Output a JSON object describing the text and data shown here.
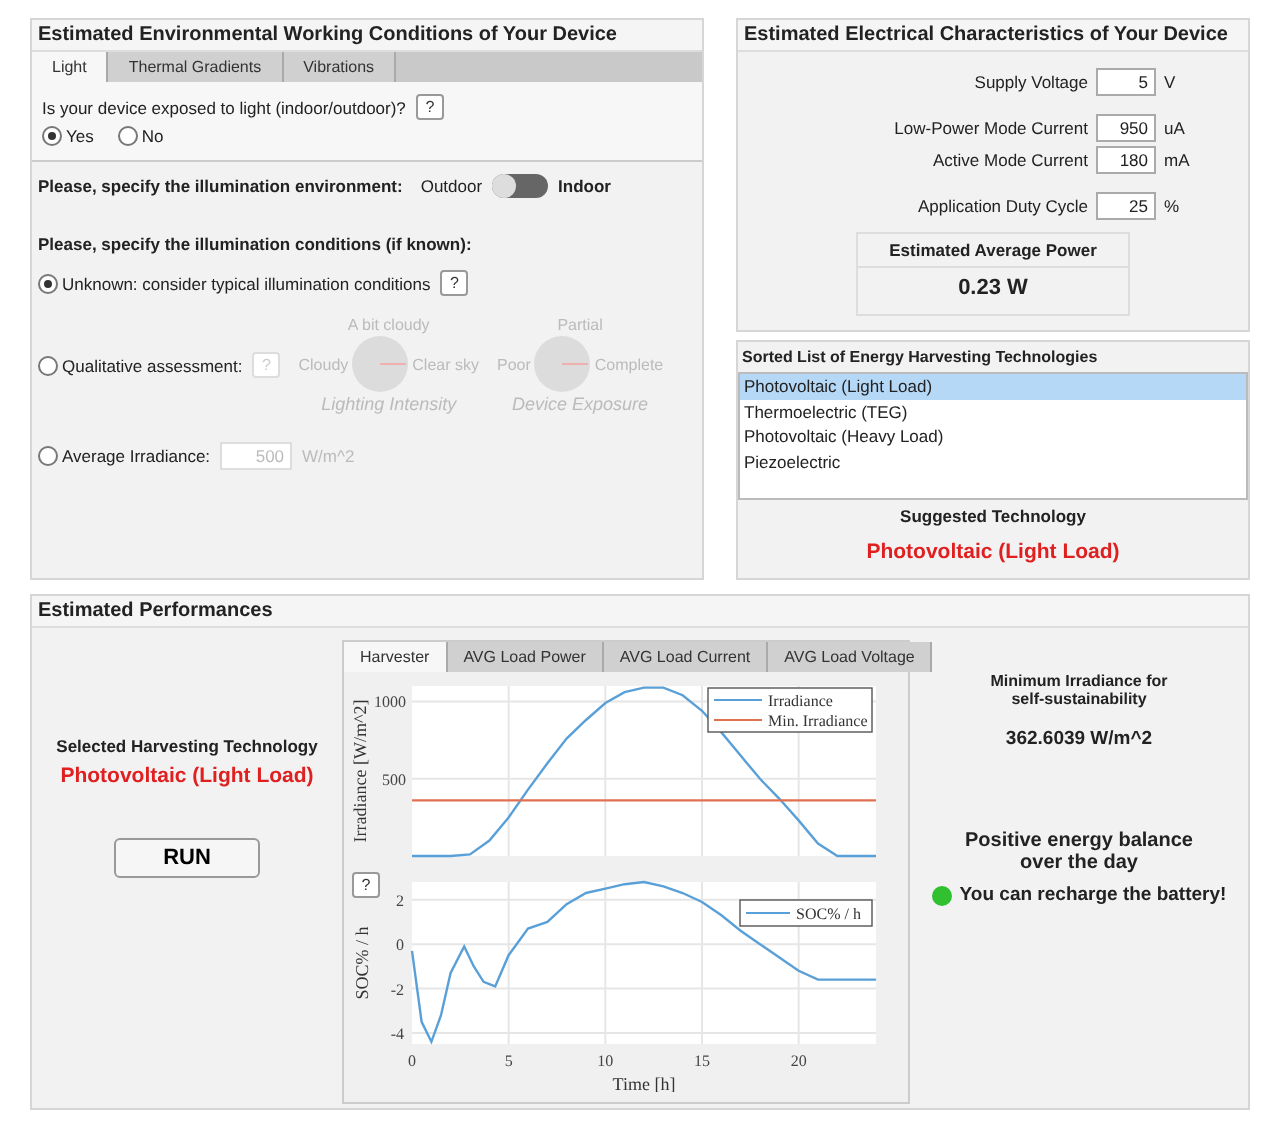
{
  "environment_panel": {
    "title": "Estimated Environmental Working Conditions of Your Device",
    "tabs": [
      {
        "label": "Light",
        "selected": true
      },
      {
        "label": "Thermal Gradients",
        "selected": false
      },
      {
        "label": "Vibrations",
        "selected": false
      }
    ],
    "exposure_question": {
      "label": "Is your device exposed to light (indoor/outdoor)?",
      "help": "?"
    },
    "exposure_options": [
      {
        "label": "Yes",
        "selected": true
      },
      {
        "label": "No",
        "selected": false
      }
    ],
    "environment": {
      "label": "Please, specify the illumination environment:",
      "left": "Outdoor",
      "right": "Indoor",
      "indoor": false
    },
    "conditions_heading": "Please, specify the illumination conditions (if known):",
    "condition_options": [
      {
        "kind": "unknown",
        "label": "Unknown: consider typical illumination conditions",
        "help": "?",
        "selected": true,
        "controls_disabled": false
      },
      {
        "kind": "qualitative",
        "label": "Qualitative assessment:",
        "help": "?",
        "selected": false,
        "controls_disabled": true,
        "knobs": [
          {
            "top": "A bit cloudy",
            "left": "Cloudy",
            "right": "Clear sky",
            "caption": "Lighting Intensity"
          },
          {
            "top": "Partial",
            "left": "Poor",
            "right": "Complete",
            "caption": "Device Exposure"
          }
        ]
      },
      {
        "kind": "irradiance",
        "label": "Average Irradiance:",
        "value": "500",
        "unit": "W/m^2",
        "selected": false,
        "controls_disabled": true
      }
    ]
  },
  "electrical_panel": {
    "title": "Estimated Electrical Characteristics of Your Device",
    "fields": [
      {
        "label": "Supply Voltage",
        "value": "5",
        "unit": "V"
      },
      {
        "label": "Low-Power Mode Current",
        "value": "950",
        "unit": "uA"
      },
      {
        "label": "Active Mode Current",
        "value": "180",
        "unit": "mA"
      },
      {
        "label": "Application Duty Cycle",
        "value": "25",
        "unit": "%"
      }
    ],
    "average_power": {
      "label": "Estimated Average Power",
      "value": "0.23 W"
    }
  },
  "technologies": {
    "title": "Sorted List of Energy Harvesting Technologies",
    "items": [
      {
        "label": "Photovoltaic (Light Load)",
        "selected": true
      },
      {
        "label": "Thermoelectric (TEG)",
        "selected": false
      },
      {
        "label": "Photovoltaic (Heavy Load)",
        "selected": false
      },
      {
        "label": "Piezoelectric",
        "selected": false
      }
    ],
    "suggested_label": "Suggested Technology",
    "suggested": "Photovoltaic (Light Load)"
  },
  "performance": {
    "title": "Estimated Performances",
    "selected_label": "Selected Harvesting Technology",
    "selected_value": "Photovoltaic (Light Load)",
    "run": "RUN",
    "tabs": [
      {
        "label": "Harvester",
        "selected": true
      },
      {
        "label": "AVG Load Power",
        "selected": false
      },
      {
        "label": "AVG Load Current",
        "selected": false
      },
      {
        "label": "AVG Load Voltage",
        "selected": false
      }
    ],
    "help": "?",
    "irradiance_chart": {
      "chart_data": {
        "type": "line",
        "grid": true,
        "legend": true,
        "ylabel": "Irradiance [W/m^2]",
        "x": [
          0,
          1,
          2,
          3,
          4,
          5,
          6,
          7,
          8,
          9,
          10,
          11,
          12,
          13,
          14,
          15,
          16,
          17,
          18,
          19,
          20,
          21,
          22,
          23,
          24
        ],
        "xlim": [
          0,
          24
        ],
        "ylim": [
          0,
          1100
        ],
        "yticks": [
          500,
          1000
        ],
        "series": [
          {
            "name": "Irradiance",
            "color": "#5aa0d8",
            "values": [
              0,
              0,
              0,
              10,
              100,
              250,
              430,
              600,
              760,
              880,
              990,
              1060,
              1090,
              1090,
              1040,
              940,
              800,
              650,
              500,
              370,
              230,
              80,
              0,
              0,
              0
            ]
          },
          {
            "name": "Min. Irradiance",
            "color": "#e07050",
            "values": [
              360,
              360,
              360,
              360,
              360,
              360,
              360,
              360,
              360,
              360,
              360,
              360,
              360,
              360,
              360,
              360,
              360,
              360,
              360,
              360,
              360,
              360,
              360,
              360,
              360
            ]
          }
        ]
      }
    },
    "soc_chart": {
      "chart_data": {
        "type": "line",
        "grid": true,
        "legend": true,
        "xlabel": "Time [h]",
        "ylabel": "SOC% / h",
        "x": [
          0,
          0.5,
          1,
          1.5,
          2,
          2.7,
          3.2,
          3.7,
          4.3,
          5,
          6,
          7,
          8,
          9,
          10,
          11,
          12,
          13,
          14,
          15,
          16,
          17,
          18,
          19,
          20,
          21,
          22,
          23,
          24
        ],
        "xlim": [
          0,
          24
        ],
        "ylim": [
          -4.5,
          2.8
        ],
        "xticks": [
          0,
          5,
          10,
          15,
          20
        ],
        "yticks": [
          -4,
          -2,
          0,
          2
        ],
        "series": [
          {
            "name": "SOC% / h",
            "color": "#5aa0d8",
            "values": [
              -0.3,
              -3.5,
              -4.4,
              -3.2,
              -1.3,
              -0.1,
              -1.0,
              -1.7,
              -1.9,
              -0.5,
              0.7,
              1.0,
              1.8,
              2.3,
              2.5,
              2.7,
              2.8,
              2.6,
              2.3,
              1.9,
              1.3,
              0.6,
              0,
              -0.6,
              -1.2,
              -1.6,
              -1.6,
              -1.6,
              -1.6
            ]
          }
        ]
      }
    },
    "min_label": "Minimum Irradiance for self-sustainability",
    "min_value": "362.6039 W/m^2",
    "balance": "Positive energy balance over the day",
    "status": {
      "text": "You can recharge the battery!",
      "positive": true
    }
  }
}
